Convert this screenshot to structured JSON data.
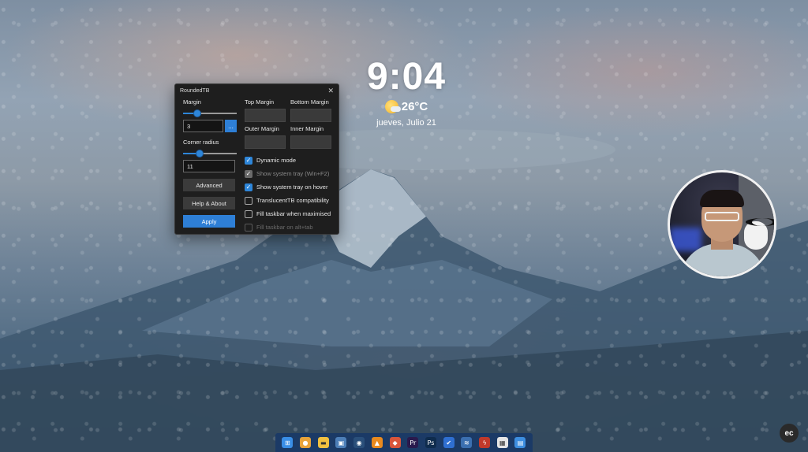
{
  "clock": {
    "time": "9:04",
    "temperature": "26°C",
    "date": "jueves, Julio 21",
    "weather_icon": "partly-sunny-icon"
  },
  "roundedtb": {
    "title": "RoundedTB",
    "close_glyph": "✕",
    "margin_label": "Margin",
    "margin_value": "3",
    "dots_button": "...",
    "corner_radius_label": "Corner radius",
    "corner_radius_value": "11",
    "advanced_button": "Advanced",
    "help_button": "Help & About",
    "apply_button": "Apply",
    "margin_slider_level": 0.22,
    "radius_slider_level": 0.27,
    "top_margin_label": "Top Margin",
    "bottom_margin_label": "Bottom Margin",
    "outer_margin_label": "Outer Margin",
    "inner_margin_label": "Inner Margin",
    "options": [
      {
        "label": "Dynamic mode",
        "checked": true,
        "enabled": true
      },
      {
        "label": "Show system tray (Win+F2)",
        "checked": true,
        "enabled": false
      },
      {
        "label": "Show system tray on hover",
        "checked": true,
        "enabled": true
      },
      {
        "label": "TranslucentTB compatibility",
        "checked": false,
        "enabled": true
      },
      {
        "label": "Fill taskbar when maximised",
        "checked": false,
        "enabled": true
      },
      {
        "label": "Fill taskbar on alt+tab",
        "checked": false,
        "enabled": false
      }
    ]
  },
  "logo": {
    "text": "ec"
  },
  "taskbar": {
    "icons": [
      {
        "name": "start-icon",
        "glyph": "⊞",
        "color": "#3a8ee6"
      },
      {
        "name": "chrome-icon",
        "glyph": "●",
        "color": "#e8a33a"
      },
      {
        "name": "file-explorer-icon",
        "glyph": "▬",
        "color": "#f0c040"
      },
      {
        "name": "app-window-icon",
        "glyph": "▣",
        "color": "#4d7fb8"
      },
      {
        "name": "steam-icon",
        "glyph": "◉",
        "color": "#2a4f7a"
      },
      {
        "name": "vlc-icon",
        "glyph": "▲",
        "color": "#e98a1f"
      },
      {
        "name": "game-icon",
        "glyph": "◆",
        "color": "#d9553a"
      },
      {
        "name": "premiere-icon",
        "glyph": "Pr",
        "color": "#2a1a4d"
      },
      {
        "name": "photoshop-icon",
        "glyph": "Ps",
        "color": "#0f2c4d"
      },
      {
        "name": "todo-icon",
        "glyph": "✔",
        "color": "#2f6fd1"
      },
      {
        "name": "network-icon",
        "glyph": "≋",
        "color": "#3b6fb0"
      },
      {
        "name": "flash-icon",
        "glyph": "ϟ",
        "color": "#c0392b"
      },
      {
        "name": "calendar-icon",
        "glyph": "▦",
        "color": "#e5e5e5"
      },
      {
        "name": "store-icon",
        "glyph": "▤",
        "color": "#3d8ee0"
      }
    ]
  }
}
